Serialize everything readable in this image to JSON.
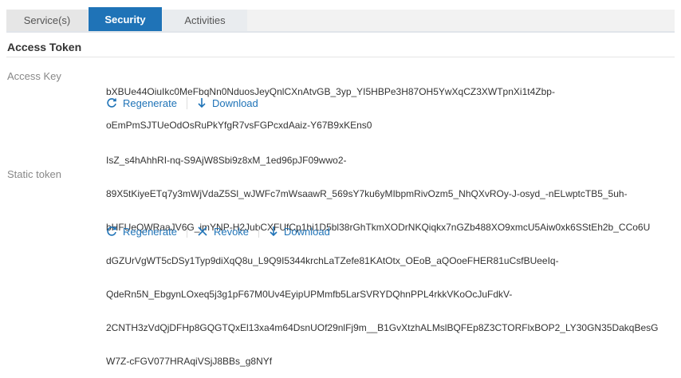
{
  "tabs": [
    {
      "label": "Service(s)"
    },
    {
      "label": "Security"
    },
    {
      "label": "Activities"
    }
  ],
  "section": {
    "title": "Access Token"
  },
  "access_key": {
    "label": "Access Key",
    "lines": [
      "bXBUe44OiuIkc0MeFbqNn0NduosJeyQnlCXnAtvGB_3yp_YI5HBPe3H87OH5YwXqCZ3XWTpnXi1t4Zbp-",
      "oEmPmSJTUeOdOsRuPkYfgR7vsFGPcxdAaiz-Y67B9xKEns0"
    ],
    "actions": {
      "regenerate": "Regenerate",
      "download": "Download"
    }
  },
  "static_token": {
    "label": "Static token",
    "lines": [
      "IsZ_s4hAhhRI-nq-S9AjW8Sbi9z8xM_1ed96pJF09wwo2-",
      "89X5tKiyeETq7y3mWjVdaZ5Sl_wJWFc7mWsaawR_569sY7ku6yMIbpmRivOzm5_NhQXvROy-J-osyd_-nELwptcTB5_5uh-",
      "bHFUeQWRaaJV6G_imYNP-H2JubCXFUfCp1hi1D5bl38rGhTkmXODrNKQiqkx7nGZb488XO9xmcU5Aiw0xk6SStEh2b_CCo6U",
      "dGZUrVgWT5cDSy1Typ9diXqQ8u_L9Q9I5344krchLaTZefe81KAtOtx_OEoB_aQOoeFHER81uCsfBUeeIq-",
      "QdeRn5N_EbgynLOxeq5j3g1pF67M0Uv4EyipUPMmfb5LarSVRYDQhnPPL4rkkVKoOcJuFdkV-",
      "2CNTH3zVdQjDFHp8GQGTQxEl13xa4m64DsnUOf29nlFj9m__B1GvXtzhALMslBQFEp8Z3CTORFlxBOP2_LY30GN35DakqBesG",
      "W7Z-cFGV077HRAqiVSjJ8BBs_g8NYf"
    ],
    "actions": {
      "regenerate": "Regenerate",
      "revoke": "Revoke",
      "download": "Download"
    }
  },
  "colors": {
    "accent": "#1f73b7",
    "label": "#888888",
    "text": "#333333"
  },
  "icons": {
    "regenerate": "refresh-icon",
    "download": "download-icon",
    "revoke": "close-icon"
  }
}
